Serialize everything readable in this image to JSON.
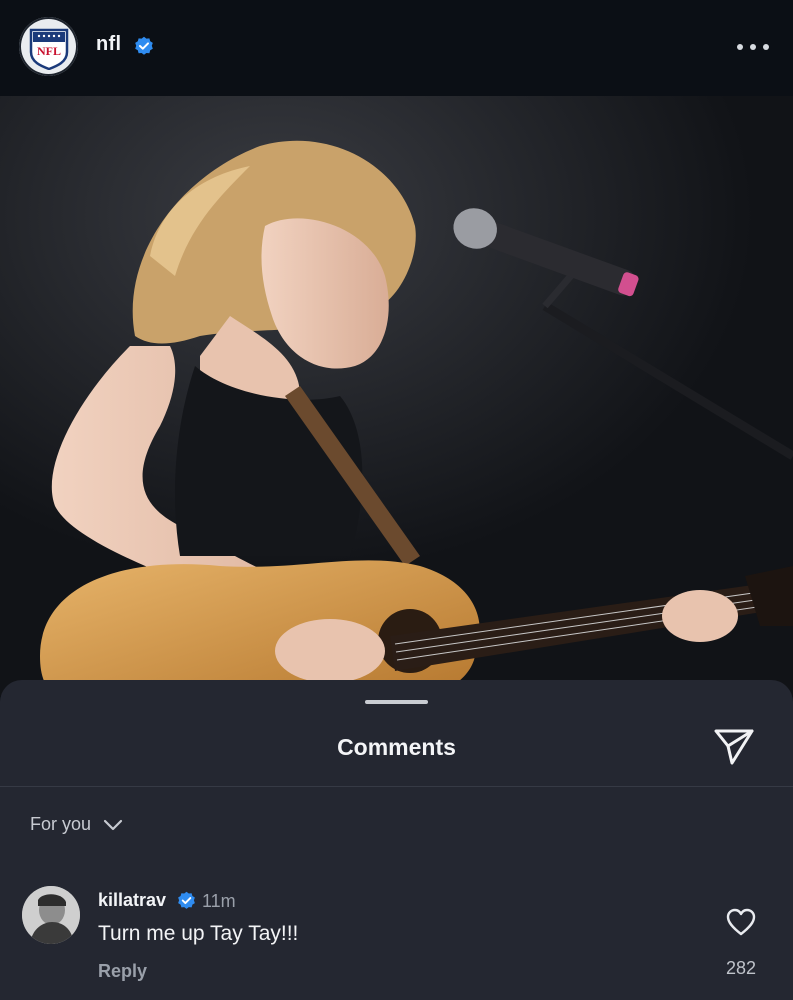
{
  "post": {
    "account": "nfl",
    "avatar_text": "NFL",
    "verified": true,
    "more_icon": "more-horizontal-icon"
  },
  "photo": {
    "description_icon": "post-photo"
  },
  "comments_sheet": {
    "title": "Comments",
    "share_icon": "send-icon",
    "filter_label": "For you",
    "filter_icon": "chevron-down-icon"
  },
  "comments": [
    {
      "username": "killatrav",
      "verified": true,
      "time": "11m",
      "text": "Turn me up Tay Tay!!!",
      "reply_label": "Reply",
      "likes": "282"
    }
  ],
  "colors": {
    "verified_blue": "#2f8cf0",
    "sheet_bg": "#242731",
    "header_bg": "#0b0f15"
  }
}
